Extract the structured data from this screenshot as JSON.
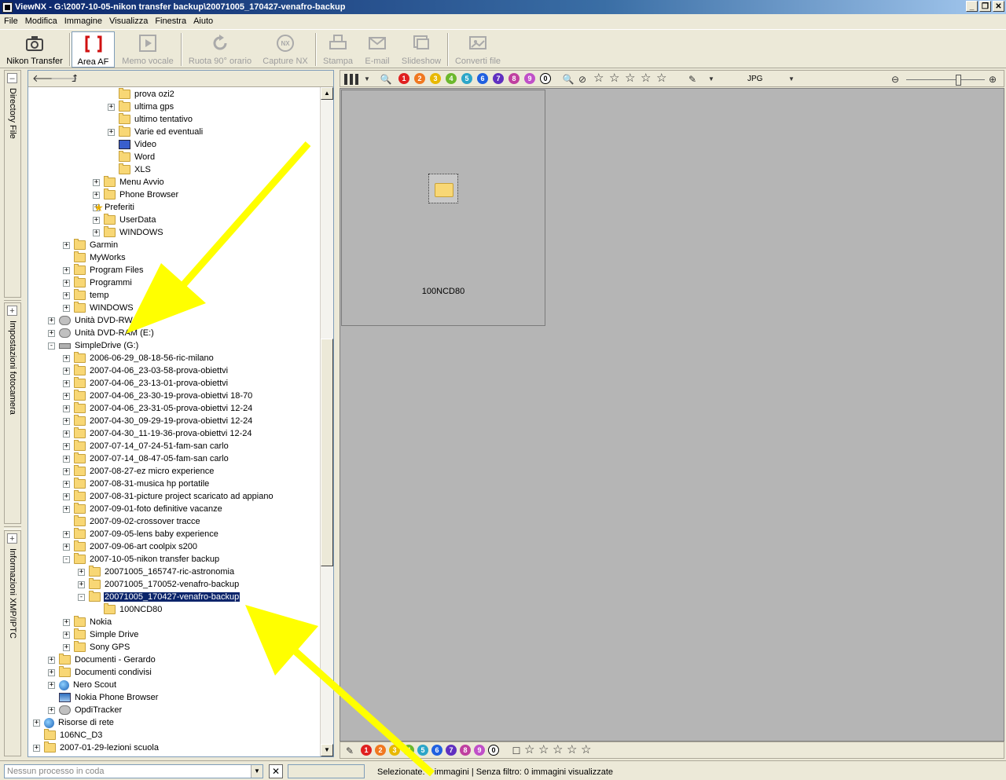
{
  "window": {
    "title": "ViewNX - G:\\2007-10-05-nikon transfer backup\\20071005_170427-venafro-backup",
    "min": "_",
    "restore": "❐",
    "close": "✕"
  },
  "menu": [
    "File",
    "Modifica",
    "Immagine",
    "Visualizza",
    "Finestra",
    "Aiuto"
  ],
  "toolbar": {
    "nikon_transfer": "Nikon Transfer",
    "area_af": "Area AF",
    "memo_vocale": "Memo vocale",
    "ruota": "Ruota 90° orario",
    "capture_nx": "Capture NX",
    "stampa": "Stampa",
    "email": "E-mail",
    "slideshow": "Slideshow",
    "converti": "Converti file"
  },
  "side_tabs": {
    "directory": "Directory File",
    "impostazioni": "Impostazioni fotocamera",
    "informazioni": "Informazioni XMP/IPTC",
    "plus": "+"
  },
  "tree_rows": [
    {
      "label": "prova ozi2",
      "indent": 5,
      "exp": "",
      "icon": "folder"
    },
    {
      "label": "ultima gps",
      "indent": 5,
      "exp": "+",
      "icon": "folder"
    },
    {
      "label": "ultimo tentativo",
      "indent": 5,
      "exp": "",
      "icon": "folder"
    },
    {
      "label": "Varie ed eventuali",
      "indent": 5,
      "exp": "+",
      "icon": "folder"
    },
    {
      "label": "Video",
      "indent": 5,
      "exp": "",
      "icon": "video"
    },
    {
      "label": "Word",
      "indent": 5,
      "exp": "",
      "icon": "folder"
    },
    {
      "label": "XLS",
      "indent": 5,
      "exp": "",
      "icon": "folder"
    },
    {
      "label": "Menu Avvio",
      "indent": 4,
      "exp": "+",
      "icon": "folder"
    },
    {
      "label": "Phone Browser",
      "indent": 4,
      "exp": "+",
      "icon": "folder"
    },
    {
      "label": "Preferiti",
      "indent": 4,
      "exp": "+",
      "icon": "star"
    },
    {
      "label": "UserData",
      "indent": 4,
      "exp": "+",
      "icon": "folder"
    },
    {
      "label": "WINDOWS",
      "indent": 4,
      "exp": "+",
      "icon": "folder"
    },
    {
      "label": "Garmin",
      "indent": 2,
      "exp": "+",
      "icon": "folder"
    },
    {
      "label": "MyWorks",
      "indent": 2,
      "exp": "",
      "icon": "folder"
    },
    {
      "label": "Program Files",
      "indent": 2,
      "exp": "+",
      "icon": "folder"
    },
    {
      "label": "Programmi",
      "indent": 2,
      "exp": "+",
      "icon": "folder"
    },
    {
      "label": "temp",
      "indent": 2,
      "exp": "+",
      "icon": "folder"
    },
    {
      "label": "WINDOWS",
      "indent": 2,
      "exp": "+",
      "icon": "folder"
    },
    {
      "label": "Unità DVD-RW (D:)",
      "indent": 1,
      "exp": "+",
      "icon": "drive"
    },
    {
      "label": "Unità DVD-RAM (E:)",
      "indent": 1,
      "exp": "+",
      "icon": "drive"
    },
    {
      "label": "SimpleDrive (G:)",
      "indent": 1,
      "exp": "-",
      "icon": "hdd"
    },
    {
      "label": "2006-06-29_08-18-56-ric-milano",
      "indent": 2,
      "exp": "+",
      "icon": "folder"
    },
    {
      "label": "2007-04-06_23-03-58-prova-obiettvi",
      "indent": 2,
      "exp": "+",
      "icon": "folder"
    },
    {
      "label": "2007-04-06_23-13-01-prova-obiettvi",
      "indent": 2,
      "exp": "+",
      "icon": "folder"
    },
    {
      "label": "2007-04-06_23-30-19-prova-obiettvi 18-70",
      "indent": 2,
      "exp": "+",
      "icon": "folder"
    },
    {
      "label": "2007-04-06_23-31-05-prova-obiettvi 12-24",
      "indent": 2,
      "exp": "+",
      "icon": "folder"
    },
    {
      "label": "2007-04-30_09-29-19-prova-obiettvi 12-24",
      "indent": 2,
      "exp": "+",
      "icon": "folder"
    },
    {
      "label": "2007-04-30_11-19-36-prova-obiettvi 12-24",
      "indent": 2,
      "exp": "+",
      "icon": "folder"
    },
    {
      "label": "2007-07-14_07-24-51-fam-san carlo",
      "indent": 2,
      "exp": "+",
      "icon": "folder"
    },
    {
      "label": "2007-07-14_08-47-05-fam-san carlo",
      "indent": 2,
      "exp": "+",
      "icon": "folder"
    },
    {
      "label": "2007-08-27-ez micro experience",
      "indent": 2,
      "exp": "+",
      "icon": "folder"
    },
    {
      "label": "2007-08-31-musica hp portatile",
      "indent": 2,
      "exp": "+",
      "icon": "folder"
    },
    {
      "label": "2007-08-31-picture project scaricato ad appiano",
      "indent": 2,
      "exp": "+",
      "icon": "folder"
    },
    {
      "label": "2007-09-01-foto definitive vacanze",
      "indent": 2,
      "exp": "+",
      "icon": "folder"
    },
    {
      "label": "2007-09-02-crossover tracce",
      "indent": 2,
      "exp": "",
      "icon": "folder"
    },
    {
      "label": "2007-09-05-lens baby experience",
      "indent": 2,
      "exp": "+",
      "icon": "folder"
    },
    {
      "label": "2007-09-06-art coolpix s200",
      "indent": 2,
      "exp": "+",
      "icon": "folder"
    },
    {
      "label": "2007-10-05-nikon transfer backup",
      "indent": 2,
      "exp": "-",
      "icon": "folder"
    },
    {
      "label": "20071005_165747-ric-astronomia",
      "indent": 3,
      "exp": "+",
      "icon": "folder"
    },
    {
      "label": "20071005_170052-venafro-backup",
      "indent": 3,
      "exp": "+",
      "icon": "folder"
    },
    {
      "label": "20071005_170427-venafro-backup",
      "indent": 3,
      "exp": "-",
      "icon": "folder",
      "selected": true
    },
    {
      "label": "100NCD80",
      "indent": 4,
      "exp": "",
      "icon": "folder"
    },
    {
      "label": "Nokia",
      "indent": 2,
      "exp": "+",
      "icon": "folder"
    },
    {
      "label": "Simple Drive",
      "indent": 2,
      "exp": "+",
      "icon": "folder"
    },
    {
      "label": "Sony GPS",
      "indent": 2,
      "exp": "+",
      "icon": "folder"
    },
    {
      "label": "Documenti - Gerardo",
      "indent": 1,
      "exp": "+",
      "icon": "folder"
    },
    {
      "label": "Documenti condivisi",
      "indent": 1,
      "exp": "+",
      "icon": "folder"
    },
    {
      "label": "Nero Scout",
      "indent": 1,
      "exp": "+",
      "icon": "net"
    },
    {
      "label": "Nokia Phone Browser",
      "indent": 1,
      "exp": "",
      "icon": "app"
    },
    {
      "label": "OpdiTracker",
      "indent": 1,
      "exp": "+",
      "icon": "drive"
    },
    {
      "label": "Risorse di rete",
      "indent": 0,
      "exp": "+",
      "icon": "net"
    },
    {
      "label": "106NC_D3",
      "indent": 0,
      "exp": "",
      "icon": "folder"
    },
    {
      "label": "2007-01-29-lezioni scuola",
      "indent": 0,
      "exp": "+",
      "icon": "folder"
    }
  ],
  "right_toolbar": {
    "format": "JPG",
    "labels": [
      "1",
      "2",
      "3",
      "4",
      "5",
      "6",
      "7",
      "8",
      "9",
      "0"
    ]
  },
  "label_colors": [
    "#e02020",
    "#f07820",
    "#e8b800",
    "#6cb82c",
    "#2ca6c8",
    "#2060e0",
    "#6030c0",
    "#c040a0",
    "#c050c8"
  ],
  "thumbnail": {
    "label": "100NCD80"
  },
  "status": {
    "queue": "Nessun processo in coda",
    "selection": "Selezionate: 0 immagini | Senza filtro: 0 immagini visualizzate"
  }
}
